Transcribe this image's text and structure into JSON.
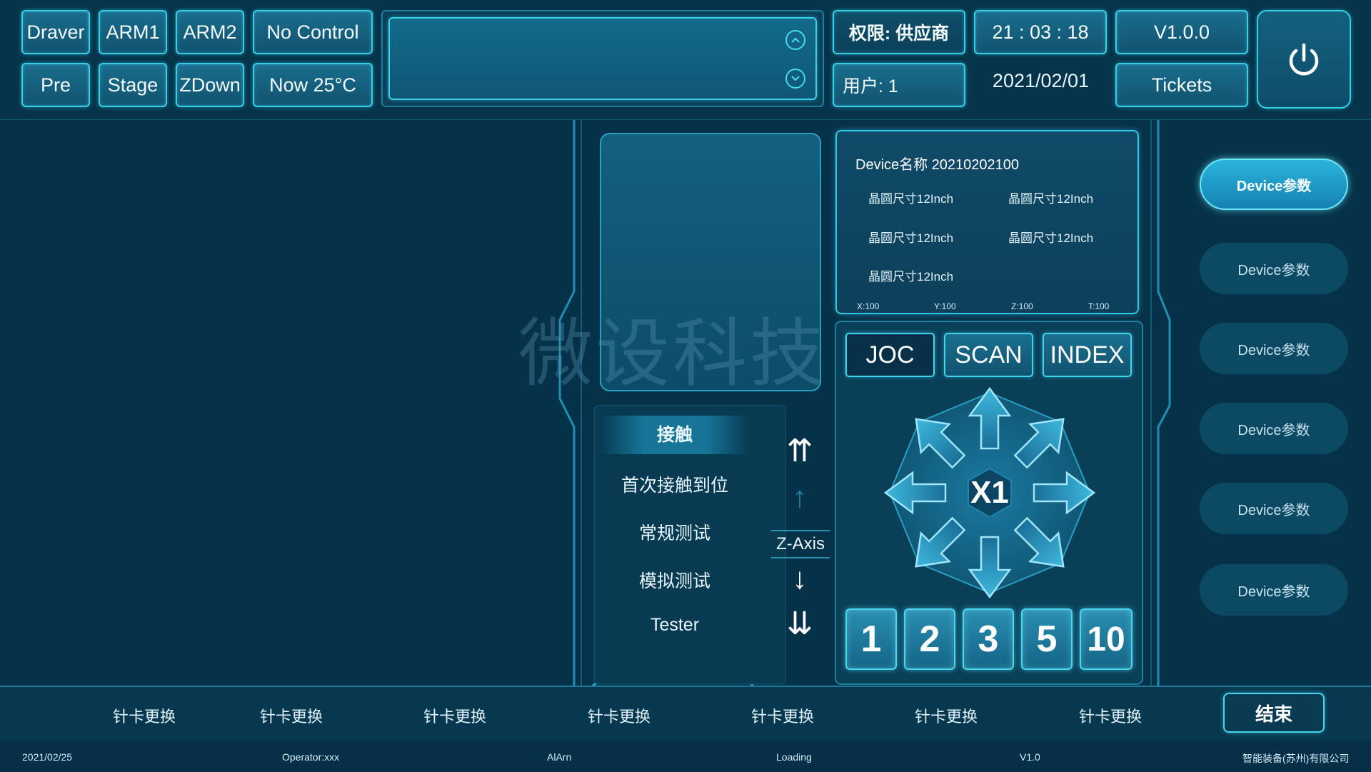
{
  "top": {
    "buttons_row1": [
      "Draver",
      "ARM1",
      "ARM2",
      "No Control"
    ],
    "buttons_row2": [
      "Pre",
      "Stage",
      "ZDown",
      "Now 25°C"
    ],
    "permission": "权限:  供应商",
    "user": "用户:      1",
    "time": "21 : 03 : 18",
    "date": "2021/02/01",
    "version": "V1.0.0",
    "tickets": "Tickets"
  },
  "watermark": "微设科技",
  "device": {
    "title": "Device名称  20210202100",
    "specs": [
      "晶圆尺寸12Inch",
      "晶圆尺寸12Inch",
      "晶圆尺寸12Inch",
      "晶圆尺寸12Inch",
      "晶圆尺寸12Inch"
    ],
    "axes": [
      "X:100",
      "Y:100",
      "Z:100",
      "T:100"
    ]
  },
  "modes": [
    "JOC",
    "SCAN",
    "INDEX"
  ],
  "active_mode": "JOC",
  "touch": {
    "items": [
      "接触",
      "首次接触到位",
      "常规测试",
      "模拟测试",
      "Tester"
    ],
    "active": "接触"
  },
  "z_axis": {
    "label": "Z-Axis",
    "arrows": [
      "⇈",
      "↑",
      "↓",
      "⇊"
    ]
  },
  "joystick": {
    "center": "X1"
  },
  "speeds": [
    "1",
    "2",
    "3",
    "5",
    "10"
  ],
  "side_buttons": [
    "Device参数",
    "Device参数",
    "Device参数",
    "Device参数",
    "Device参数",
    "Device参数"
  ],
  "probe_cards": [
    "针卡更换",
    "针卡更换",
    "针卡更换",
    "针卡更换",
    "针卡更换",
    "针卡更换",
    "针卡更换"
  ],
  "end_label": "结束",
  "status": {
    "date": "2021/02/25",
    "operator": "Operator:xxx",
    "alarm": "AlArn",
    "loading": "Loading",
    "version": "V1.0",
    "company": "智能装备(苏州)有限公司"
  },
  "colors": {
    "background": "#063249",
    "accent": "#35cfe6",
    "active_side": "#2ab4dc"
  }
}
